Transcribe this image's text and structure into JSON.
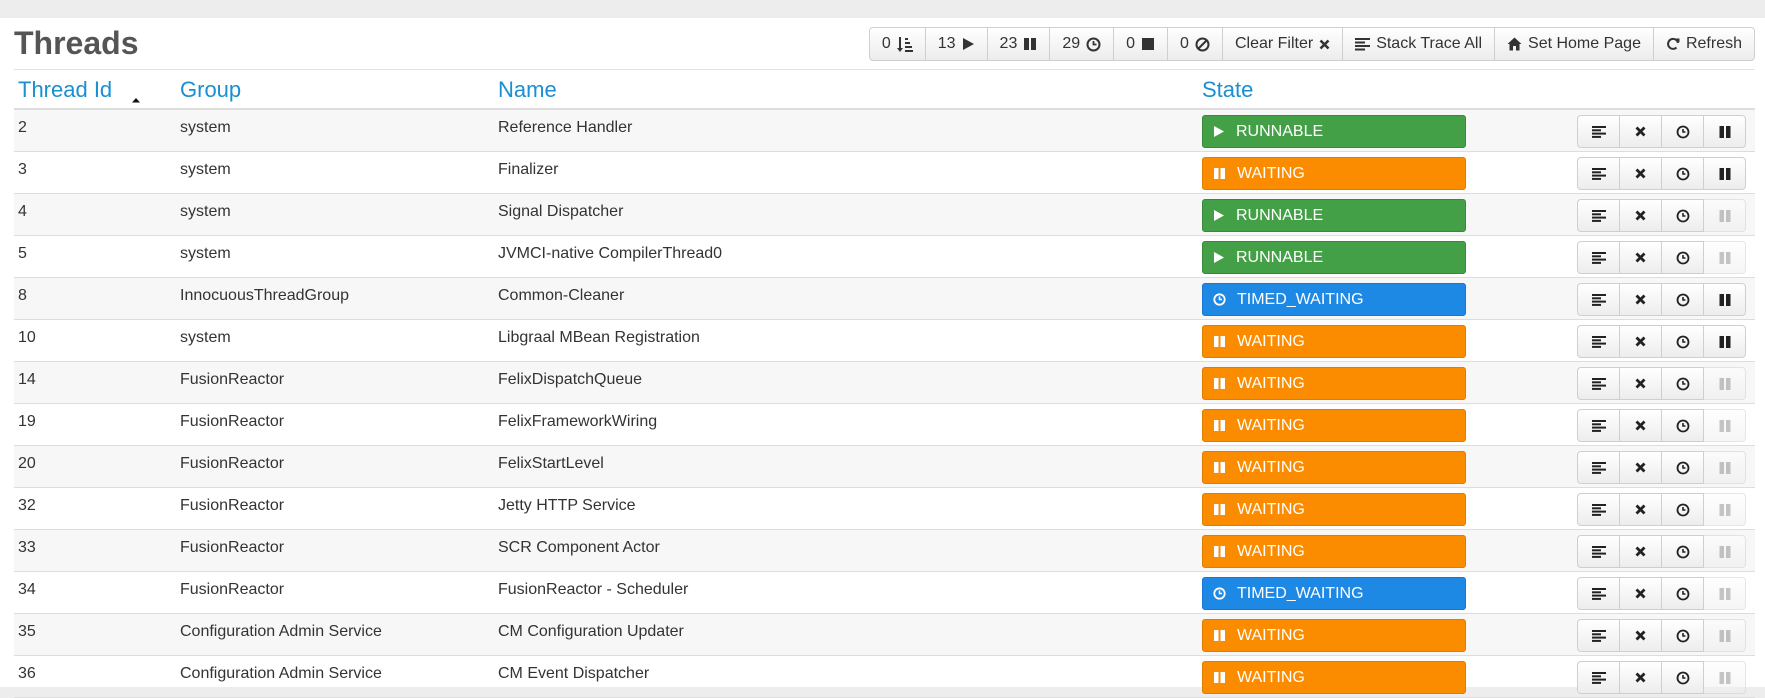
{
  "page": {
    "title": "Threads"
  },
  "toolbar": {
    "new_count": "0",
    "runnable_count": "13",
    "waiting_count": "23",
    "timed_waiting_count": "29",
    "terminated_count": "0",
    "blocked_count": "0",
    "clear_filter_label": "Clear Filter",
    "stack_trace_all_label": "Stack Trace All",
    "set_home_page_label": "Set Home Page",
    "refresh_label": "Refresh"
  },
  "table": {
    "columns": {
      "id": "Thread Id",
      "group": "Group",
      "name": "Name",
      "state": "State"
    },
    "sort": {
      "column": "Thread Id",
      "direction": "ascending"
    },
    "rows": [
      {
        "id": "2",
        "group": "system",
        "name": "Reference Handler",
        "state": "RUNNABLE",
        "suspend_enabled": true
      },
      {
        "id": "3",
        "group": "system",
        "name": "Finalizer",
        "state": "WAITING",
        "suspend_enabled": true
      },
      {
        "id": "4",
        "group": "system",
        "name": "Signal Dispatcher",
        "state": "RUNNABLE",
        "suspend_enabled": false
      },
      {
        "id": "5",
        "group": "system",
        "name": "JVMCI-native CompilerThread0",
        "state": "RUNNABLE",
        "suspend_enabled": false
      },
      {
        "id": "8",
        "group": "InnocuousThreadGroup",
        "name": "Common-Cleaner",
        "state": "TIMED_WAITING",
        "suspend_enabled": true
      },
      {
        "id": "10",
        "group": "system",
        "name": "Libgraal MBean Registration",
        "state": "WAITING",
        "suspend_enabled": true
      },
      {
        "id": "14",
        "group": "FusionReactor",
        "name": "FelixDispatchQueue",
        "state": "WAITING",
        "suspend_enabled": false
      },
      {
        "id": "19",
        "group": "FusionReactor",
        "name": "FelixFrameworkWiring",
        "state": "WAITING",
        "suspend_enabled": false
      },
      {
        "id": "20",
        "group": "FusionReactor",
        "name": "FelixStartLevel",
        "state": "WAITING",
        "suspend_enabled": false
      },
      {
        "id": "32",
        "group": "FusionReactor",
        "name": "Jetty HTTP Service",
        "state": "WAITING",
        "suspend_enabled": false
      },
      {
        "id": "33",
        "group": "FusionReactor",
        "name": "SCR Component Actor",
        "state": "WAITING",
        "suspend_enabled": false
      },
      {
        "id": "34",
        "group": "FusionReactor",
        "name": "FusionReactor - Scheduler",
        "state": "TIMED_WAITING",
        "suspend_enabled": false
      },
      {
        "id": "35",
        "group": "Configuration Admin Service",
        "name": "CM Configuration Updater",
        "state": "WAITING",
        "suspend_enabled": false
      },
      {
        "id": "36",
        "group": "Configuration Admin Service",
        "name": "CM Event Dispatcher",
        "state": "WAITING",
        "suspend_enabled": false
      }
    ]
  },
  "colors": {
    "runnable": "#43a047",
    "waiting": "#fb8c00",
    "timed_waiting": "#1e88e5",
    "header_link": "#1a8fd1",
    "title": "#555555"
  },
  "icons": {
    "new": "sort-amount-icon",
    "runnable": "play-icon",
    "waiting": "pause-icon",
    "timed_waiting": "clock-icon",
    "terminated": "stop-icon",
    "blocked": "ban-icon",
    "clear_filter": "close-icon",
    "stack_trace": "align-left-icon",
    "home": "home-icon",
    "refresh": "refresh-icon",
    "row_actions": [
      "stack-trace-icon",
      "kill-icon",
      "profile-clock-icon",
      "suspend-icon"
    ]
  }
}
